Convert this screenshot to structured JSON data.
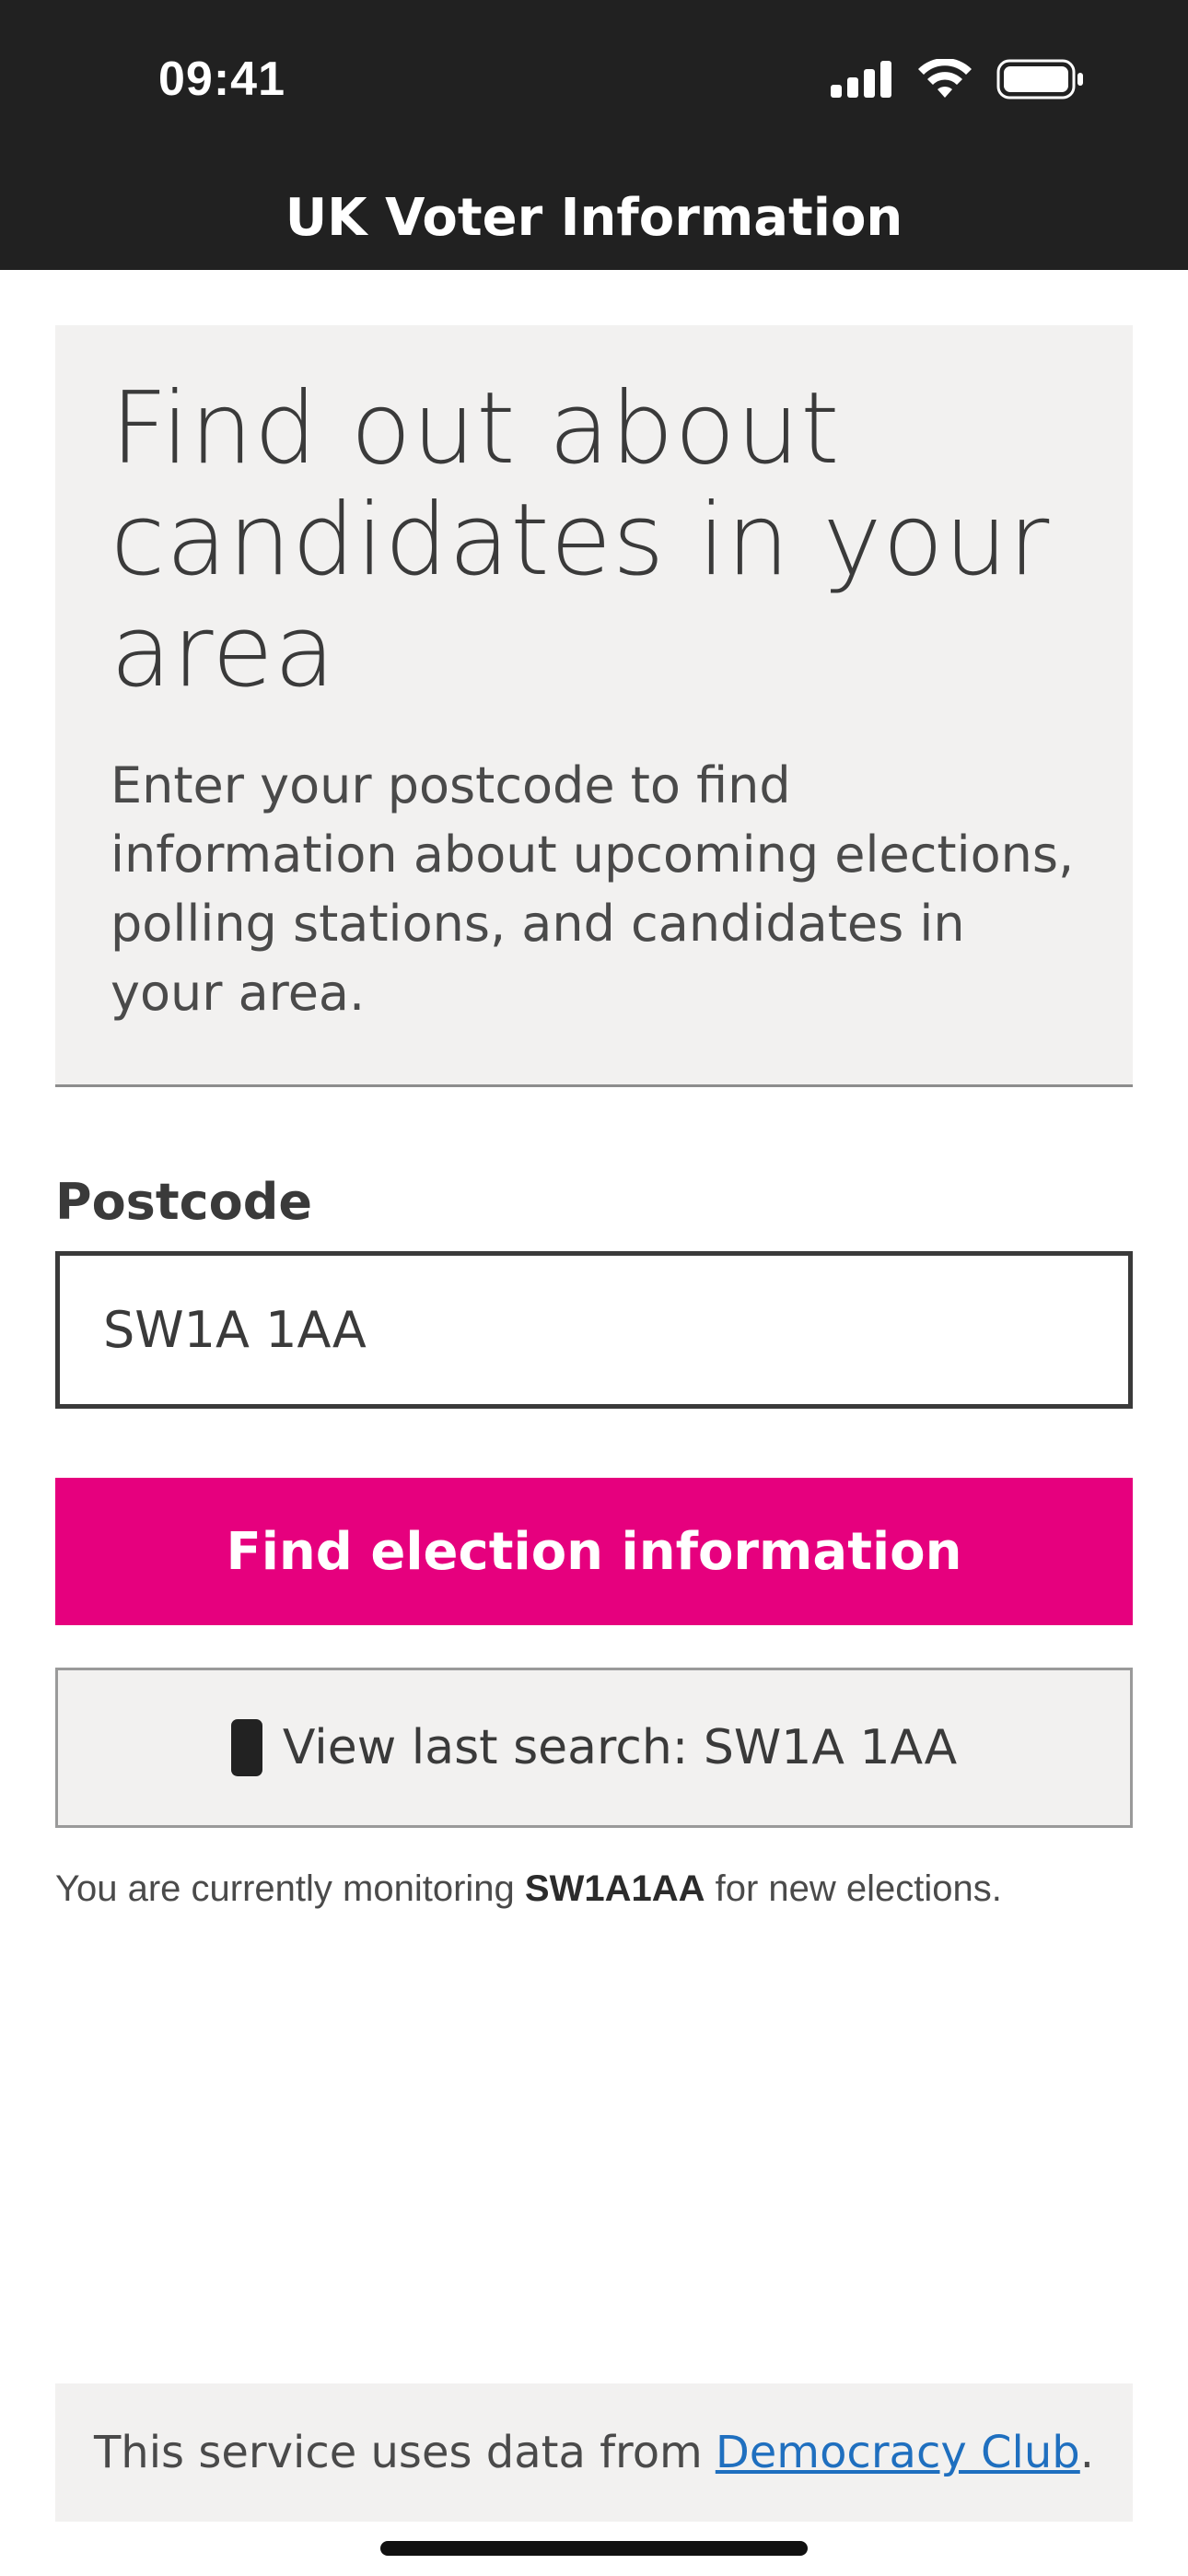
{
  "status_bar": {
    "time": "09:41",
    "icons": [
      "cellular-signal-icon",
      "wifi-icon",
      "battery-icon"
    ]
  },
  "header": {
    "title": "UK Voter Information"
  },
  "hero": {
    "title": "Find out about candidates in your area",
    "body": "Enter your postcode to find information about upcoming elections, polling stations, and candidates in your area."
  },
  "form": {
    "label": "Postcode",
    "postcode_value": "SW1A 1AA",
    "submit_label": "Find election information"
  },
  "last_search": {
    "icon": "mobile-phone-icon",
    "label": "View last search: SW1A 1AA"
  },
  "monitoring": {
    "prefix": "You are currently monitoring ",
    "postcode": "SW1A1AA",
    "suffix": " for new elections."
  },
  "footer": {
    "text": "This service uses data from",
    "link_text": "Democracy Club",
    "after_link": "."
  },
  "colors": {
    "header_bg": "#212121",
    "accent": "#e6007e",
    "panel_bg": "#f2f1f0",
    "link": "#1f6fbf"
  }
}
